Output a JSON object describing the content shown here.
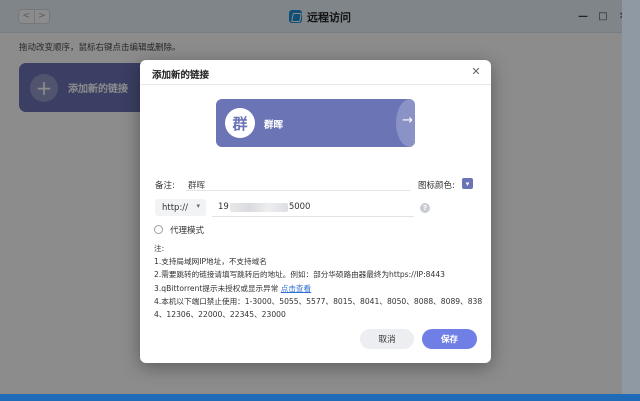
{
  "window": {
    "title": "远程访问",
    "back_glyph": "<",
    "forward_glyph": ">",
    "controls": {
      "close": "✕",
      "maximize": "□",
      "minimize": "—"
    }
  },
  "background": {
    "hint": "拖动改变顺序，鼠标右键点击编辑或删除。",
    "add_card_label": "添加新的链接",
    "add_card_glyph": "+"
  },
  "dialog": {
    "title": "添加新的链接",
    "close_glyph": "✕",
    "preview": {
      "icon_char": "群",
      "name": "群晖",
      "arrow_glyph": "→",
      "color": "#6b74b4"
    },
    "remark": {
      "label": "备注:",
      "value": "群晖"
    },
    "icon_color": {
      "label": "图标颜色:",
      "value": "#6b74b4",
      "chevron": "▾"
    },
    "address": {
      "protocol": "http://",
      "protocol_chevron": "▾",
      "value_prefix": "19",
      "value_suffix": "5000",
      "help_glyph": "?"
    },
    "proxy_mode": {
      "label": "代理模式",
      "checked": false
    },
    "notes": {
      "title": "注:",
      "line1": "1.支持局域网IP地址，不支持域名",
      "line2": "2.需要跳转的链接请填写跳转后的地址。例如：部分华硕路由器最终为https://IP:8443",
      "line3_text": "3.qBittorrent提示未授权或显示异常 ",
      "line3_link": "点击查看",
      "line4a": "4.本机以下端口禁止使用：1-3000、5055、5577、8015、8041、8050、8088、8089、838",
      "line4b": "4、12306、22000、22345、23000"
    },
    "buttons": {
      "cancel": "取消",
      "save": "保存"
    }
  }
}
